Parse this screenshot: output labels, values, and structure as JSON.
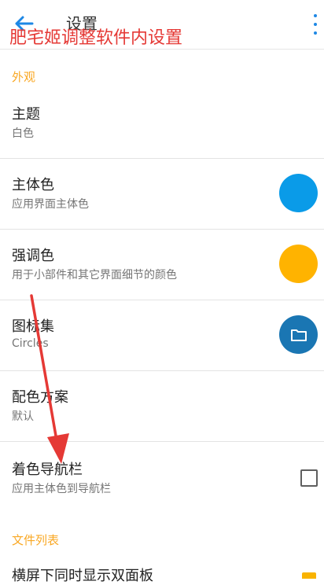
{
  "header": {
    "back_icon": "arrow-left-icon",
    "title": "设置",
    "overflow_icon": "more-vert-icon"
  },
  "annotation": {
    "text": "肥宅姬调整软件内设置",
    "color": "#e53935"
  },
  "sections": [
    {
      "title": "外观"
    },
    {
      "title": "文件列表"
    }
  ],
  "settings": {
    "theme": {
      "label": "主题",
      "value": "白色"
    },
    "primary_color": {
      "label": "主体色",
      "description": "应用界面主体色",
      "color": "#0a9be8"
    },
    "accent_color": {
      "label": "强调色",
      "description": "用于小部件和其它界面细节的颜色",
      "color": "#ffb300"
    },
    "icon_set": {
      "label": "图标集",
      "value": "Circles",
      "color": "#1a76b3",
      "icon": "folder-icon"
    },
    "color_scheme": {
      "label": "配色方案",
      "value": "默认"
    },
    "tint_navbar": {
      "label": "着色导航栏",
      "description": "应用主体色到导航栏",
      "checked": false
    },
    "dual_pane": {
      "label": "横屏下同时显示双面板"
    }
  },
  "colors": {
    "accent_text": "#f9a825",
    "appbar_icon": "#1e88e5"
  }
}
